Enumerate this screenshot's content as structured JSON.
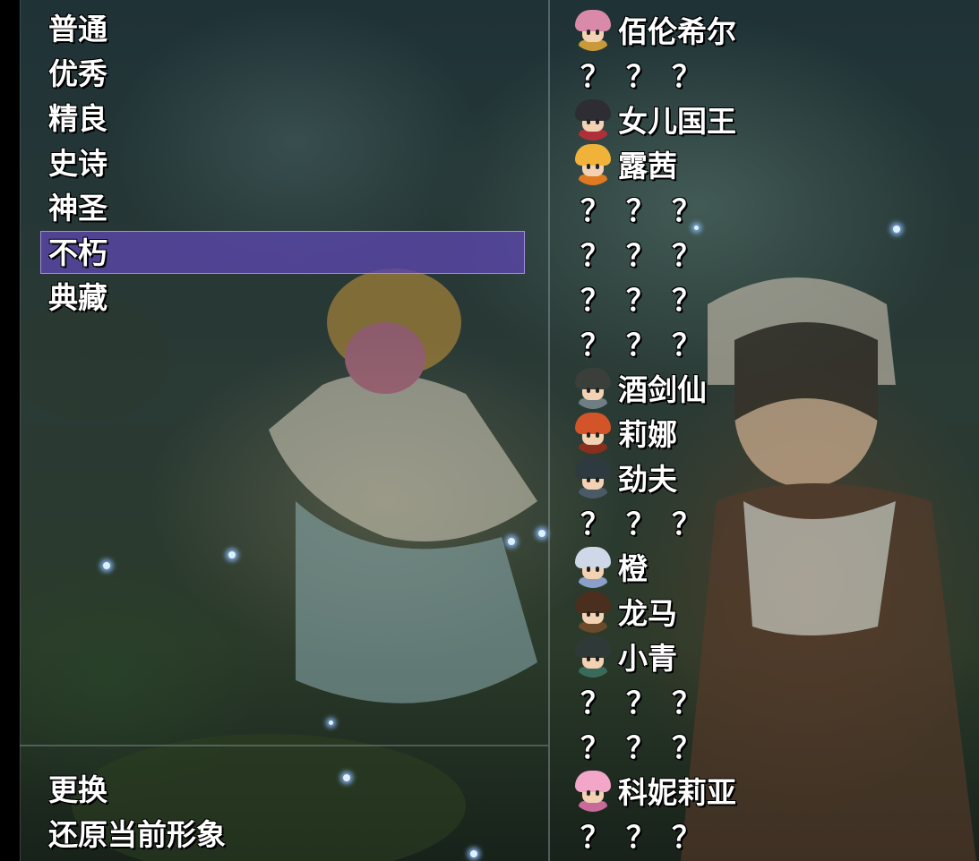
{
  "categories": [
    {
      "label": "普通"
    },
    {
      "label": "优秀"
    },
    {
      "label": "精良"
    },
    {
      "label": "史诗"
    },
    {
      "label": "神圣"
    },
    {
      "label": "不朽"
    },
    {
      "label": "典藏"
    }
  ],
  "selected_category": "不朽",
  "actions": {
    "change_label": "更换",
    "restore_label": "还原当前形象"
  },
  "characters": [
    {
      "name": "佰伦希尔",
      "unlocked": true,
      "avatar": "knight-helmet-icon",
      "hair": "#d98aa8",
      "body": "#c89a3a"
    },
    {
      "name": "？？？",
      "unlocked": false
    },
    {
      "name": "女儿国王",
      "unlocked": true,
      "avatar": "dark-hair-girl-icon",
      "hair": "#2d2d33",
      "body": "#b0303a"
    },
    {
      "name": "露茜",
      "unlocked": true,
      "avatar": "blonde-girl-icon",
      "hair": "#f1b23a",
      "body": "#e07a20"
    },
    {
      "name": "？？？",
      "unlocked": false
    },
    {
      "name": "？？？",
      "unlocked": false
    },
    {
      "name": "？？？",
      "unlocked": false
    },
    {
      "name": "？？？",
      "unlocked": false
    },
    {
      "name": "酒剑仙",
      "unlocked": true,
      "avatar": "swordsman-icon",
      "hair": "#3a3f3a",
      "body": "#6d7f85"
    },
    {
      "name": "莉娜",
      "unlocked": true,
      "avatar": "red-hair-girl-icon",
      "hair": "#d4542a",
      "body": "#8a2f1f"
    },
    {
      "name": "劲夫",
      "unlocked": true,
      "avatar": "fighter-icon",
      "hair": "#2e3a3f",
      "body": "#4a5a66"
    },
    {
      "name": "？？？",
      "unlocked": false
    },
    {
      "name": "橙",
      "unlocked": true,
      "avatar": "armored-robot-icon",
      "hair": "#cfd8e8",
      "body": "#8aa0c8"
    },
    {
      "name": "龙马",
      "unlocked": true,
      "avatar": "brown-hair-boy-icon",
      "hair": "#4a2e1e",
      "body": "#6a4a2a"
    },
    {
      "name": "小青",
      "unlocked": true,
      "avatar": "green-hair-girl-icon",
      "hair": "#2f3a38",
      "body": "#3a6a5a"
    },
    {
      "name": "？？？",
      "unlocked": false
    },
    {
      "name": "？？？",
      "unlocked": false
    },
    {
      "name": "科妮莉亚",
      "unlocked": true,
      "avatar": "pink-hair-girl-icon",
      "hair": "#f2a6c8",
      "body": "#c86a9a"
    },
    {
      "name": "？？？",
      "unlocked": false
    }
  ],
  "colors": {
    "selection": "#5a46aa",
    "text": "#ffffff"
  }
}
